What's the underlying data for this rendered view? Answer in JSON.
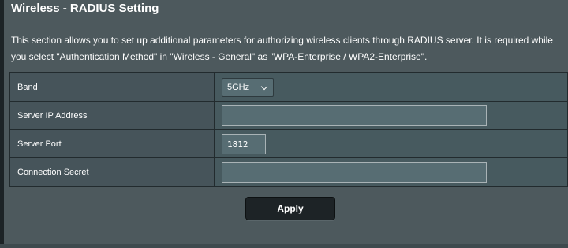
{
  "page": {
    "title": "Wireless - RADIUS Setting",
    "description_line1": "This section allows you to set up additional parameters for authorizing wireless clients through RADIUS server. It is required while",
    "description_line2": "you select \"Authentication Method\" in \"Wireless - General\" as \"WPA-Enterprise / WPA2-Enterprise\"."
  },
  "form": {
    "band": {
      "label": "Band",
      "selected": "5GHz"
    },
    "server_ip": {
      "label": "Server IP Address",
      "value": ""
    },
    "server_port": {
      "label": "Server Port",
      "value": "1812"
    },
    "connection_secret": {
      "label": "Connection Secret",
      "value": ""
    }
  },
  "actions": {
    "apply_label": "Apply"
  },
  "colors": {
    "background": "#4d595d",
    "button": "#1d2326",
    "text": "#ffffff"
  }
}
